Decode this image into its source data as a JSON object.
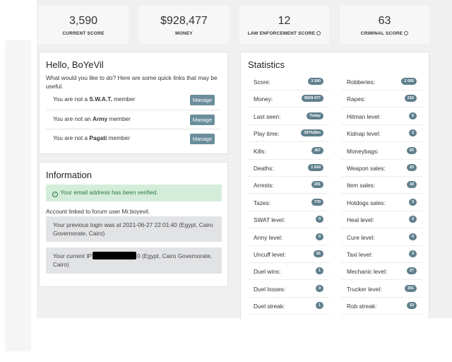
{
  "top_stats": [
    {
      "value": "3,590",
      "label": "CURRENT SCORE",
      "info": false
    },
    {
      "value": "$928,477",
      "label": "MONEY",
      "info": false
    },
    {
      "value": "12",
      "label": "LAW ENFORCEMENT SCORE",
      "info": true
    },
    {
      "value": "63",
      "label": "CRIMINAL SCORE",
      "info": true
    }
  ],
  "hello": {
    "title": "Hello, BoYeVil",
    "intro": "What would you like to do? Here are some quick links that may be useful.",
    "manage_label": "Manage",
    "memberships": [
      {
        "pre": "You are not a ",
        "group": "S.W.A.T.",
        "post": " member"
      },
      {
        "pre": "You are not an ",
        "group": "Army",
        "post": " member"
      },
      {
        "pre": "You are not a ",
        "group": "Pagati",
        "post": " member"
      }
    ]
  },
  "information": {
    "title": "Information",
    "email_verified": "Your email address has been verified.",
    "forum_link": "Account linked to forum user Mr.boyevil.",
    "previous_login": "Your previous login was at 2021-06-27 22:01:40 (Egypt, Cairo Governorate, Cairo)",
    "current_ip_prefix": "Your current IP",
    "current_ip_suffix": "0 (Egypt, Cairo Governorate, Cairo)"
  },
  "statistics": {
    "title": "Statistics",
    "left": [
      {
        "label": "Score:",
        "value": "3 590"
      },
      {
        "label": "Money:",
        "value": "$928 477"
      },
      {
        "label": "Last seen:",
        "value": "Today"
      },
      {
        "label": "Play time:",
        "value": "307h28m"
      },
      {
        "label": "Kills:",
        "value": "367"
      },
      {
        "label": "Deaths:",
        "value": "1 624"
      },
      {
        "label": "Arrests:",
        "value": "291"
      },
      {
        "label": "Tazes:",
        "value": "770"
      },
      {
        "label": "SWAT level:",
        "value": "0"
      },
      {
        "label": "Army level:",
        "value": "0"
      },
      {
        "label": "Uncuff level:",
        "value": "56"
      },
      {
        "label": "Duel wins:",
        "value": "1"
      },
      {
        "label": "Duel losses:",
        "value": "0"
      },
      {
        "label": "Duel streak:",
        "value": "1"
      }
    ],
    "right": [
      {
        "label": "Robberies:",
        "value": "2 005"
      },
      {
        "label": "Rapes:",
        "value": "216"
      },
      {
        "label": "Hitman level:",
        "value": "6"
      },
      {
        "label": "Kidnap level:",
        "value": "2"
      },
      {
        "label": "Moneybags:",
        "value": "50"
      },
      {
        "label": "Weapon sales:",
        "value": "20"
      },
      {
        "label": "Item sales:",
        "value": "18"
      },
      {
        "label": "Hotdogs sales:",
        "value": "3"
      },
      {
        "label": "Heal level:",
        "value": "2"
      },
      {
        "label": "Cure level:",
        "value": "0"
      },
      {
        "label": "Taxi level:",
        "value": "3"
      },
      {
        "label": "Mechanic level:",
        "value": "27"
      },
      {
        "label": "Trucker level:",
        "value": "301"
      },
      {
        "label": "Rob streak:",
        "value": "10"
      }
    ]
  }
}
